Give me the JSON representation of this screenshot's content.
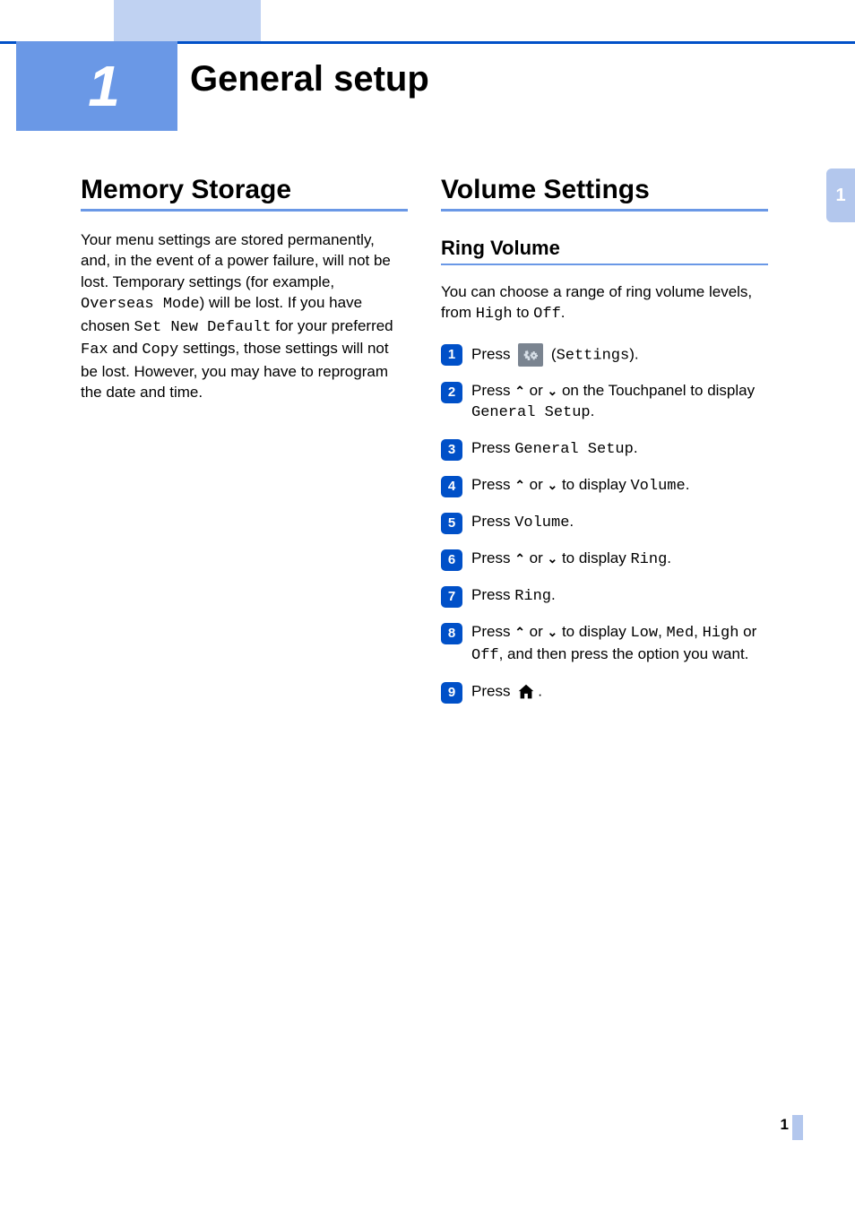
{
  "chapter": {
    "number": "1",
    "title": "General setup"
  },
  "side_tab": "1",
  "left": {
    "section_title": "Memory Storage",
    "para": {
      "t1": "Your menu settings are stored permanently, and, in the event of a power failure, will not be lost. Temporary settings (for example, ",
      "mono1": "Overseas Mode",
      "t2": ") will be lost. If you have chosen ",
      "mono2": "Set New Default",
      "t3": " for your preferred ",
      "mono3": "Fax",
      "t4": " and ",
      "mono4": "Copy",
      "t5": " settings, those settings will not be lost. However, you may have to reprogram the date and time."
    }
  },
  "right": {
    "section_title": "Volume Settings",
    "subsection_title": "Ring Volume",
    "intro": {
      "t1": "You can choose a range of ring volume levels, from ",
      "mono1": "High",
      "t2": " to ",
      "mono2": "Off",
      "t3": "."
    },
    "steps": [
      {
        "n": "1",
        "a": "Press ",
        "b": " (",
        "mono1": "Settings",
        "c": ")."
      },
      {
        "n": "2",
        "a": "Press ",
        "arrow_up": "︿",
        "b": " or ",
        "arrow_dn": "﹀",
        "c": " on the Touchpanel to display ",
        "mono1": "General Setup",
        "d": "."
      },
      {
        "n": "3",
        "a": "Press ",
        "mono1": "General Setup",
        "b": "."
      },
      {
        "n": "4",
        "a": "Press ",
        "arrow_up": "︿",
        "b": " or ",
        "arrow_dn": "﹀",
        "c": " to display ",
        "mono1": "Volume",
        "d": "."
      },
      {
        "n": "5",
        "a": "Press ",
        "mono1": "Volume",
        "b": "."
      },
      {
        "n": "6",
        "a": "Press ",
        "arrow_up": "︿",
        "b": " or ",
        "arrow_dn": "﹀",
        "c": " to display ",
        "mono1": "Ring",
        "d": "."
      },
      {
        "n": "7",
        "a": "Press ",
        "mono1": "Ring",
        "b": "."
      },
      {
        "n": "8",
        "a": "Press ",
        "arrow_up": "︿",
        "b": " or ",
        "arrow_dn": "﹀",
        "c": " to display ",
        "mono1": "Low",
        "d": ", ",
        "mono2": "Med",
        "e": ", ",
        "mono3": "High",
        "f": " or ",
        "mono4": "Off",
        "g": ", and then press the option you want."
      },
      {
        "n": "9",
        "a": "Press ",
        "home": true,
        "b": "."
      }
    ]
  },
  "page_number": "1"
}
